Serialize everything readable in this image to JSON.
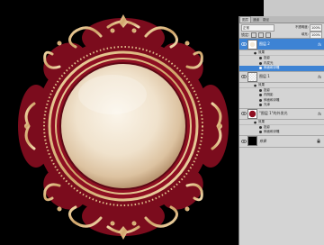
{
  "panel": {
    "tabs": [
      "图层",
      "通道",
      "路径"
    ],
    "blend_mode": "正常",
    "opacity_label": "不透明度:",
    "opacity_value": "100%",
    "fill_label": "填充:",
    "fill_value": "100%",
    "lock_label": "锁定:"
  },
  "layers": [
    {
      "name": "图层 2",
      "selected": true,
      "effects_label": "效果",
      "effects": [
        "投影",
        "内发光",
        "斜面和浮雕"
      ]
    },
    {
      "name": "图层 1",
      "selected": false,
      "effects_label": "效果",
      "effects": [
        "投影",
        "内阴影",
        "斜面和浮雕",
        "光泽"
      ]
    },
    {
      "name": "\"图层 1\"的外发光",
      "selected": false,
      "effects_label": "效果",
      "effects": [
        "投影",
        "斜面和浮雕"
      ]
    },
    {
      "name": "背景",
      "selected": false
    }
  ],
  "colors": {
    "frame_red": "#8e0f22",
    "frame_gold": "#d9b27a",
    "disc_light": "#f4e9d7",
    "selection_blue": "#3d83d4"
  }
}
